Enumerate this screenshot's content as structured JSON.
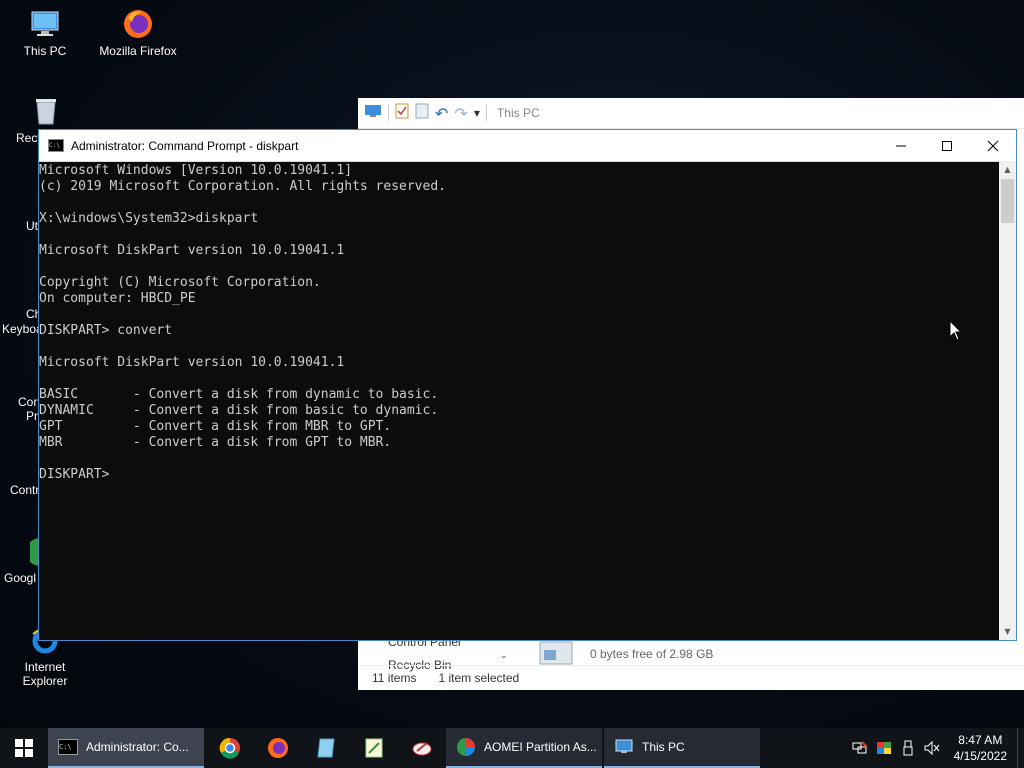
{
  "desktop": {
    "icons": [
      {
        "label": "This PC"
      },
      {
        "label": "Mozilla Firefox"
      },
      {
        "label": "Internet Explorer"
      }
    ],
    "partial_labels": [
      "Recy",
      "Ut",
      "Ch",
      "Keyboa",
      "Con",
      "Pr",
      "Contr",
      "Googl"
    ]
  },
  "explorer": {
    "title": "This PC",
    "peek_nav_item": "Control Panel",
    "peek_nav_item2": "Recycle Bin",
    "peek_drive_text": "0 bytes free of 2.98 GB",
    "status_items": "11 items",
    "status_selected": "1 item selected"
  },
  "cmd": {
    "title": "Administrator: Command Prompt - diskpart",
    "console_text": "Microsoft Windows [Version 10.0.19041.1]\n(c) 2019 Microsoft Corporation. All rights reserved.\n\nX:\\windows\\System32>diskpart\n\nMicrosoft DiskPart version 10.0.19041.1\n\nCopyright (C) Microsoft Corporation.\nOn computer: HBCD_PE\n\nDISKPART> convert\n\nMicrosoft DiskPart version 10.0.19041.1\n\nBASIC       - Convert a disk from dynamic to basic.\nDYNAMIC     - Convert a disk from basic to dynamic.\nGPT         - Convert a disk from MBR to GPT.\nMBR         - Convert a disk from GPT to MBR.\n\nDISKPART> "
  },
  "taskbar": {
    "items": [
      {
        "label": "Administrator: Co..."
      },
      {
        "label": "AOMEI Partition As..."
      },
      {
        "label": "This PC"
      }
    ],
    "clock": {
      "time": "8:47 AM",
      "date": "4/15/2022"
    }
  },
  "colors": {
    "console_bg": "#0c0c0c",
    "console_fg": "#cccccc",
    "taskbar_bg": "#101419",
    "accent": "#8ab4e0"
  }
}
